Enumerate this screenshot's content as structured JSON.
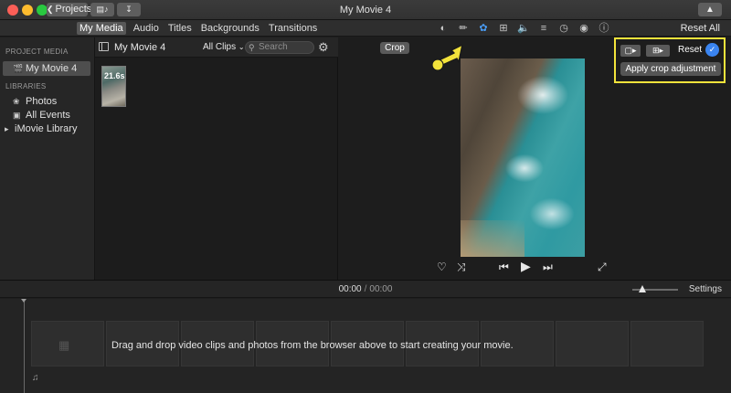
{
  "window": {
    "title": "My Movie 4",
    "projects_label": "Projects"
  },
  "media_tabs": [
    "My Media",
    "Audio",
    "Titles",
    "Backgrounds",
    "Transitions"
  ],
  "toolbar": {
    "reset_all": "Reset All"
  },
  "sidebar": {
    "section_project": "PROJECT MEDIA",
    "project_item": "My Movie 4",
    "section_libraries": "LIBRARIES",
    "library_items": [
      "Photos",
      "All Events",
      "iMovie Library"
    ]
  },
  "browser": {
    "title": "My Movie 4",
    "filter": "All Clips",
    "search_placeholder": "Search",
    "clip_duration": "21.6s"
  },
  "viewer": {
    "mode_label": "Crop",
    "crop_panel": {
      "reset": "Reset",
      "apply": "Apply crop adjustment"
    }
  },
  "timeline": {
    "current_time": "00:00",
    "separator": "/",
    "total_time": "00:00",
    "settings": "Settings",
    "hint": "Drag and drop video clips and photos from the browser above to start creating your movie."
  },
  "colors": {
    "accent": "#3a84f0",
    "highlight": "#f3e33b"
  }
}
